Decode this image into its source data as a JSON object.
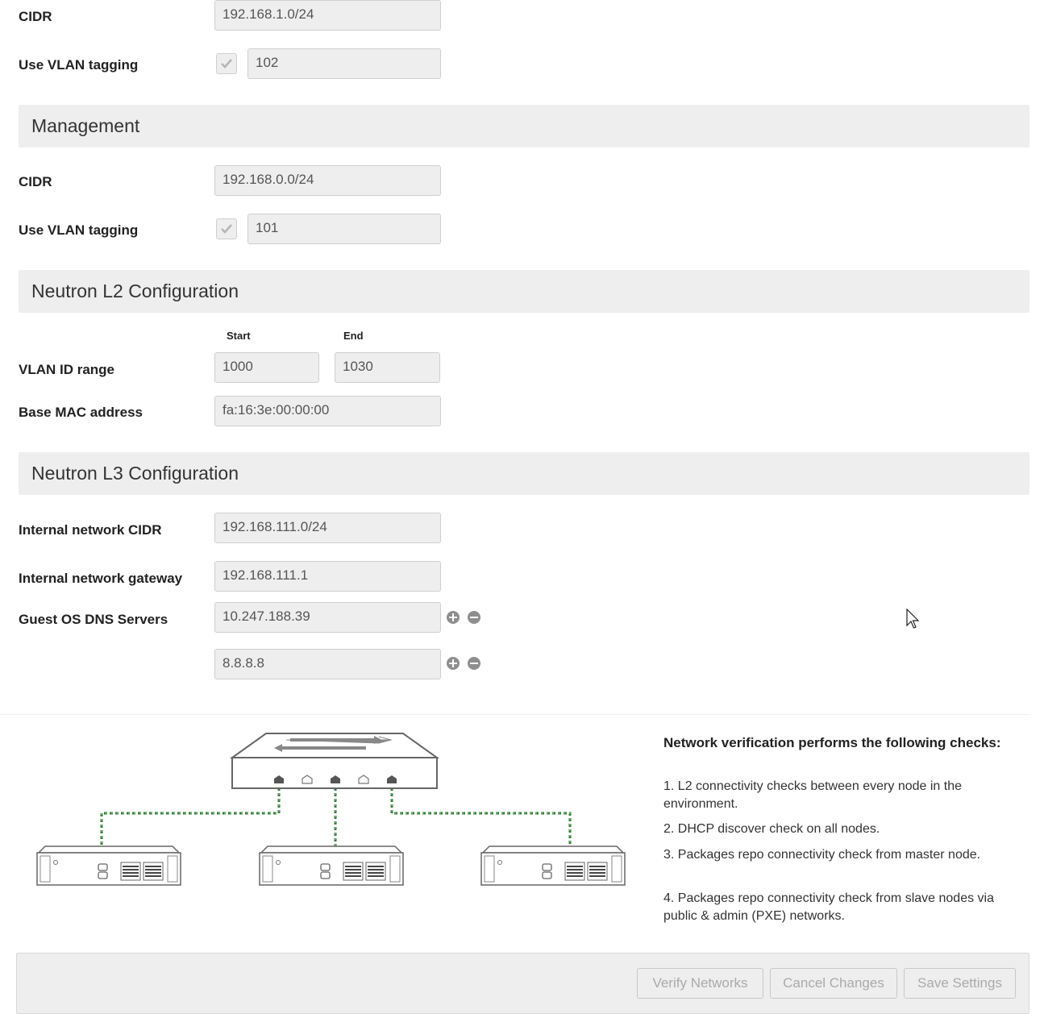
{
  "storage": {
    "cidr_label": "CIDR",
    "cidr_value": "192.168.1.0/24",
    "vlan_label": "Use VLAN tagging",
    "vlan_value": "102"
  },
  "management": {
    "title": "Management",
    "cidr_label": "CIDR",
    "cidr_value": "192.168.0.0/24",
    "vlan_label": "Use VLAN tagging",
    "vlan_value": "101"
  },
  "l2": {
    "title": "Neutron L2 Configuration",
    "start_label": "Start",
    "end_label": "End",
    "vlan_range_label": "VLAN ID range",
    "vlan_start": "1000",
    "vlan_end": "1030",
    "mac_label": "Base MAC address",
    "mac_value": "fa:16:3e:00:00:00"
  },
  "l3": {
    "title": "Neutron L3 Configuration",
    "internal_cidr_label": "Internal network CIDR",
    "internal_cidr_value": "192.168.111.0/24",
    "gateway_label": "Internal network gateway",
    "gateway_value": "192.168.111.1",
    "dns_label": "Guest OS DNS Servers",
    "dns_servers": [
      "10.247.188.39",
      "8.8.8.8"
    ]
  },
  "verification": {
    "title": "Network verification performs the following checks:",
    "checks": [
      "1. L2 connectivity checks between every node in the environment.",
      "2. DHCP discover check on all nodes.",
      "3. Packages repo connectivity check from master node.",
      "4. Packages repo connectivity check from slave nodes via public & admin (PXE) networks."
    ]
  },
  "buttons": {
    "verify": "Verify Networks",
    "cancel": "Cancel Changes",
    "save": "Save Settings"
  },
  "colors": {
    "section_bg": "#eeeeee",
    "input_bg": "#eeeeee",
    "cable": "#2e7d32"
  },
  "icons": [
    "checkbox-checked-icon",
    "add-circle-icon",
    "remove-circle-icon",
    "mouse-cursor-icon",
    "network-switch-icon",
    "server-node-icon"
  ]
}
